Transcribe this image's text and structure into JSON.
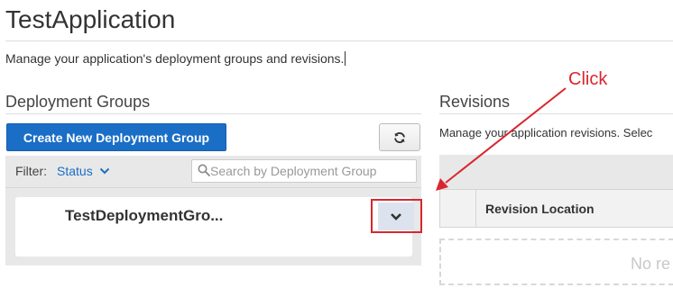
{
  "app": {
    "title": "TestApplication",
    "subtitle": "Manage your application's deployment groups and revisions."
  },
  "deployment_groups": {
    "heading": "Deployment Groups",
    "create_button_label": "Create New Deployment Group",
    "refresh_icon": "refresh-icon",
    "filter_label": "Filter:",
    "filter_value": "Status",
    "search_placeholder": "Search by Deployment Group",
    "groups": [
      {
        "name": "TestDeploymentGro..."
      }
    ]
  },
  "revisions": {
    "heading": "Revisions",
    "description": "Manage your application revisions. Selec",
    "columns": [
      "Revision Location"
    ],
    "empty_text": "No re"
  },
  "annotation": {
    "label": "Click",
    "color": "#d9262e"
  },
  "colors": {
    "primary": "#1a6ec6",
    "annotation": "#d9262e"
  }
}
